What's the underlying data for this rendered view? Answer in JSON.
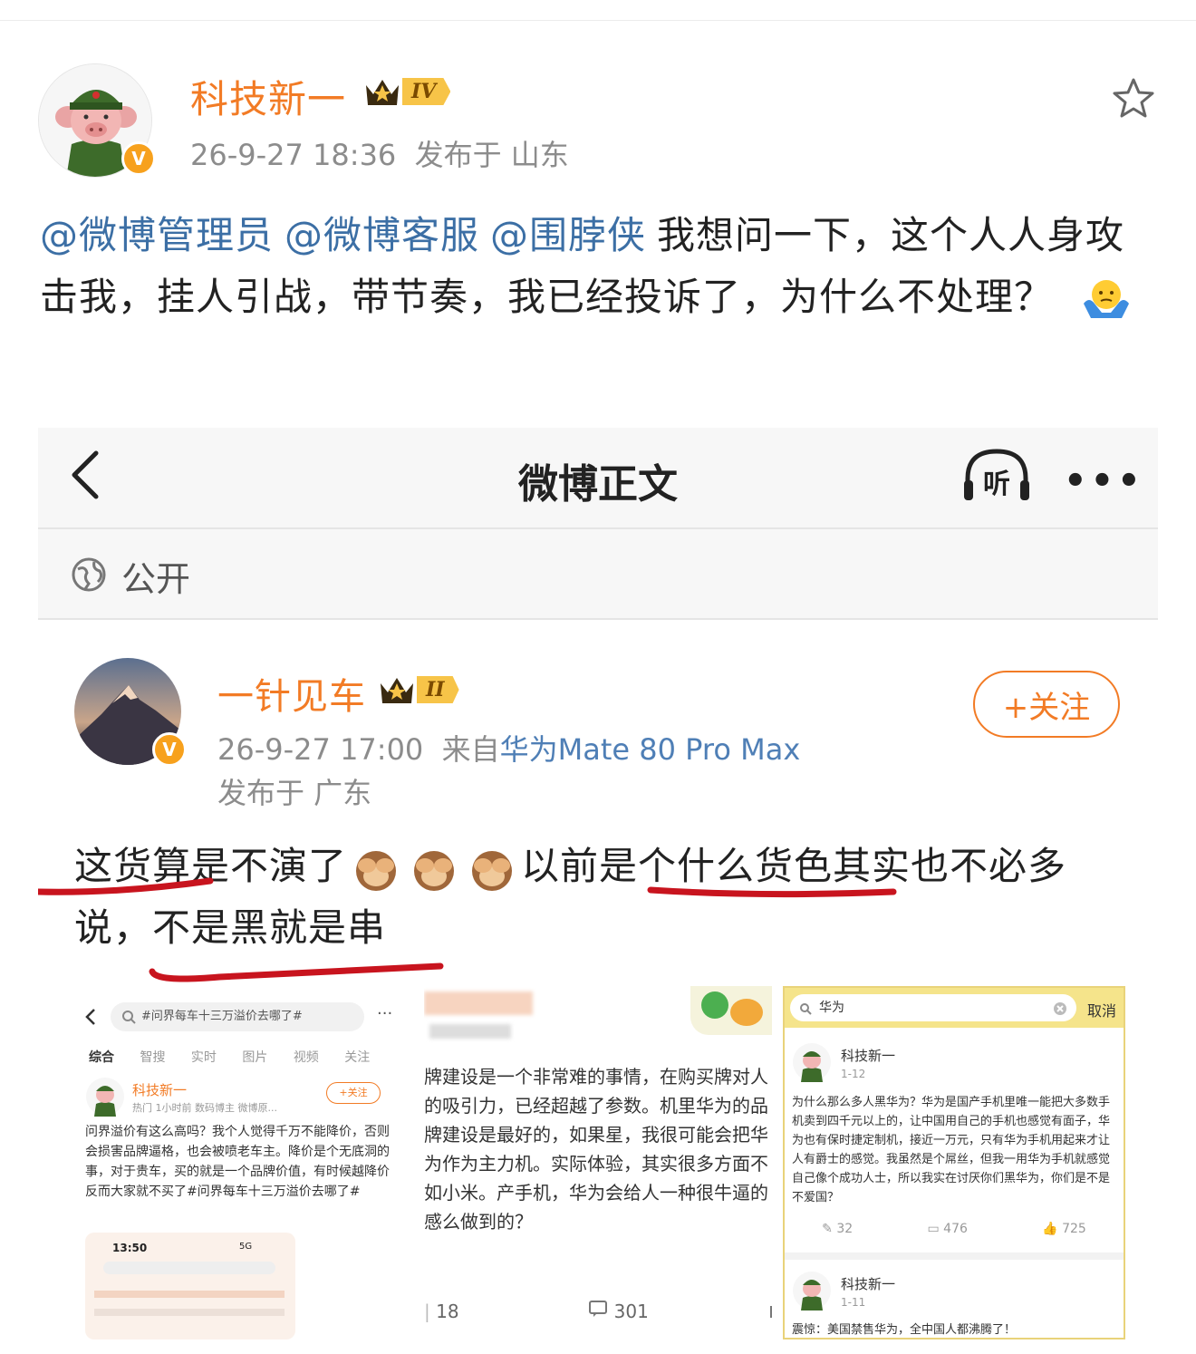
{
  "post": {
    "author": "科技新一",
    "level_badge": "IV",
    "timestamp": "26-9-27 18:36",
    "location": "发布于 山东",
    "mentions": [
      "@微博管理员",
      "@微博客服",
      "@围脖侠"
    ],
    "text": "我想问一下，这个人人身攻击我，挂人引战，带节奏，我已经投诉了，为什么不处理？",
    "verified_mark": "V"
  },
  "screenshot": {
    "nav_title": "微博正文",
    "listen_label": "听",
    "more_label": "•••",
    "visibility": "公开",
    "inner_post": {
      "author": "一针见车",
      "level_badge": "II",
      "follow_label": "+关注",
      "timestamp": "26-9-27 17:00",
      "source_prefix": "来自",
      "device": "华为Mate 80 Pro Max",
      "location": "发布于 广东",
      "text_part1": "这货算是不演了",
      "text_part2": "以前是个什么货色其实也不必多说，不是黑就是串",
      "verified_mark": "V"
    },
    "thumb1": {
      "search": "#问界每车十三万溢价去哪了#",
      "tabs": [
        "综合",
        "智搜",
        "实时",
        "图片",
        "视频",
        "关注"
      ],
      "author": "科技新一",
      "follow": "+关注",
      "meta": "热门 1小时前 数码博主 微博原...",
      "body": "问界溢价有这么高吗？我个人觉得千万不能降价，否则会损害品牌逼格，也会被喷老车主。降价是个无底洞的事，对于贵车，买的就是一个品牌价值，有时候越降价反而大家就不买了#问界每车十三万溢价去哪了#",
      "phone_time": "13:50",
      "phone_signal": "5G"
    },
    "thumb2": {
      "body": "牌建设是一个非常难的事情，在购买牌对人的吸引力，已经超越了参数。机里华为的品牌建设是最好的，如果星，我很可能会把华为作为主力机。实际体验，其实很多方面不如小米。产手机，华为会给人一种很牛逼的感么做到的？",
      "stat_repost": "18",
      "stat_comment": "301"
    },
    "thumb3": {
      "search": "华为",
      "cancel": "取消",
      "author": "科技新一",
      "date": "1-12",
      "body": "为什么那么多人黑华为？华为是国产手机里唯一能把大多数手机卖到四千元以上的，让中国用自己的手机也感觉有面子，华为也有保时捷定制机，接近一万元，只有华为手机用起来才让人有爵士的感觉。我虽然是个屌丝，但我一用华为手机就感觉自己像个成功人士，所以我实在讨厌你们黑华为，你们是不是不爱国？",
      "stat_repost": "32",
      "stat_comment": "476",
      "stat_like": "725",
      "author2": "科技新一",
      "date2": "1-11",
      "body2": "震惊：美国禁售华为，全中国人都沸腾了！"
    }
  },
  "colors": {
    "accent": "#f27b25",
    "mention": "#3c6fa5",
    "underline": "#c8141e"
  }
}
